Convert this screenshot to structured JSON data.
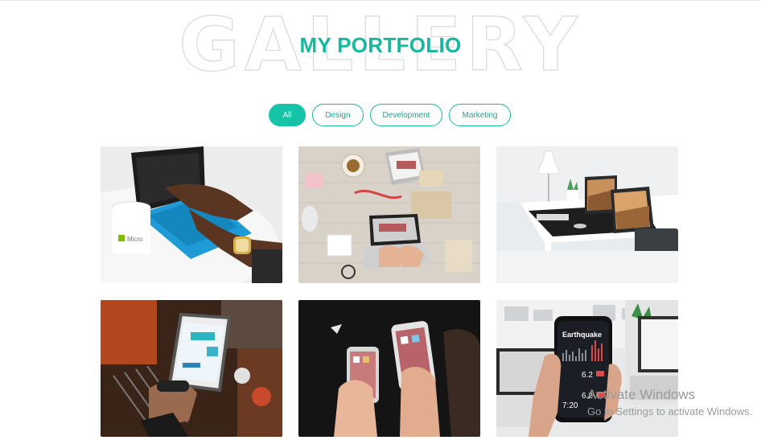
{
  "section": {
    "background_title": "GALLERY",
    "title": "MY PORTFOLIO",
    "accent_color": "#17b8a0"
  },
  "filters": [
    {
      "label": "All",
      "active": true
    },
    {
      "label": "Design",
      "active": false
    },
    {
      "label": "Development",
      "active": false
    },
    {
      "label": "Marketing",
      "active": false
    }
  ],
  "gallery": {
    "items": [
      {
        "image": "laptop-blue-keyboard-with-coffee-cup"
      },
      {
        "image": "desk-flatlay-laptop-and-crafts"
      },
      {
        "image": "white-desk-with-two-laptops"
      },
      {
        "image": "hand-holding-scanner-device"
      },
      {
        "image": "two-people-holding-phones"
      },
      {
        "image": "hand-holding-phone-earthquake-app"
      }
    ],
    "texts": {
      "cup_brand": "Micro",
      "phone_app_title": "Earthquake",
      "phone_readout_1": "6.2",
      "phone_readout_2": "6.2",
      "phone_time": "7:20"
    }
  },
  "os_watermark": {
    "line1": "Activate Windows",
    "line2": "Go to Settings to activate Windows."
  }
}
